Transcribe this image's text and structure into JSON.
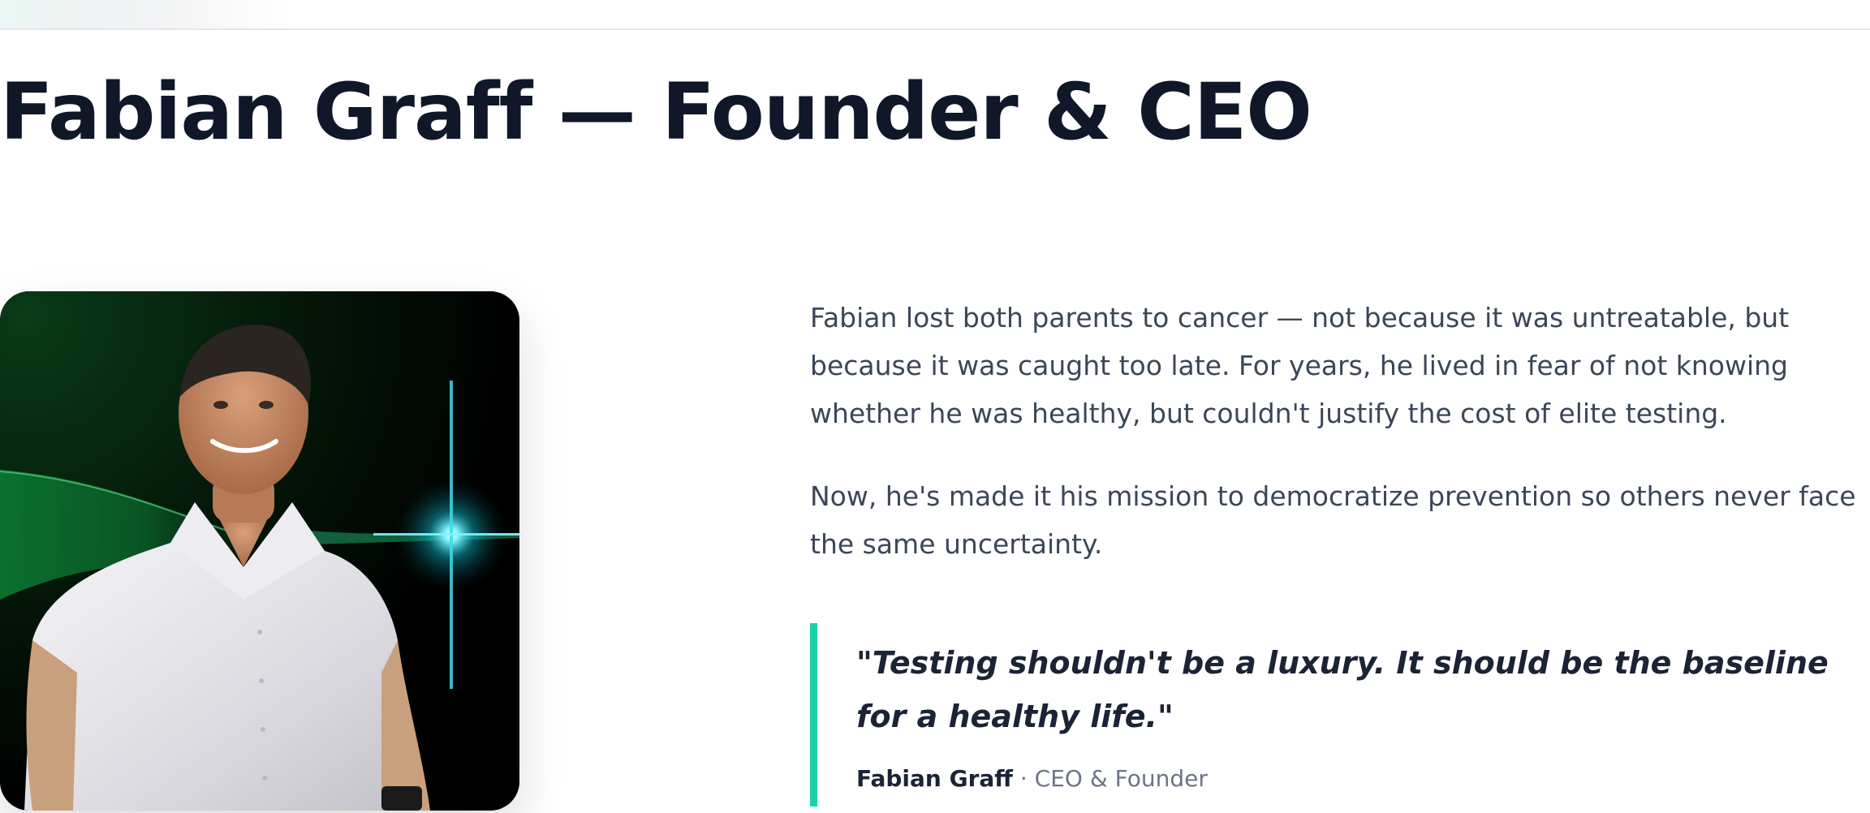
{
  "header": {
    "title": "Fabian Graff — Founder & CEO"
  },
  "photo": {
    "alt": "Fabian Graff"
  },
  "bio": {
    "paragraphs": [
      "Fabian lost both parents to cancer — not because it was untreatable, but because it was caught too late. For years, he lived in fear of not knowing whether he was healthy, but couldn't justify the cost of elite testing.",
      "Now, he's made it his mission to democratize prevention so others never face the same uncertainty."
    ]
  },
  "quote": {
    "text": "\"Testing shouldn't be a luxury. It should be the baseline for a healthy life.\"",
    "author": "Fabian Graff",
    "separator": " · ",
    "role": "CEO & Founder"
  },
  "colors": {
    "accent": "#1bd3aa",
    "heading": "#0f1729",
    "body": "#3c4658",
    "muted": "#6b7486"
  }
}
